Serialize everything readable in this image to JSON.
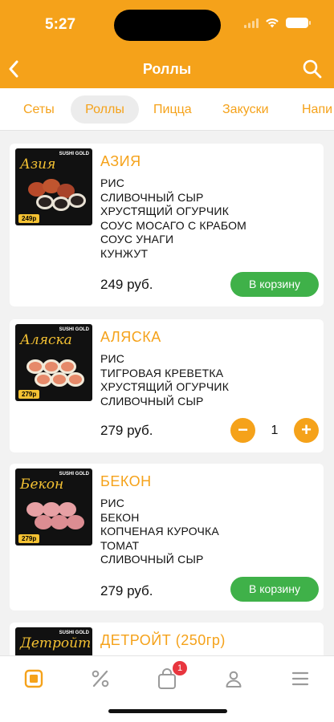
{
  "status_bar": {
    "time": "5:27"
  },
  "nav": {
    "title": "Роллы"
  },
  "tabs": [
    {
      "label": "Сеты"
    },
    {
      "label": "Роллы"
    },
    {
      "label": "Пицца"
    },
    {
      "label": "Закуски"
    },
    {
      "label": "Напи"
    }
  ],
  "products": [
    {
      "name": "АЗИЯ",
      "thumb_name": "Азия",
      "thumb_brand": "SUSHI GOLD",
      "thumb_price": "249р",
      "ingredients": [
        "РИС",
        "СЛИВОЧНЫЙ СЫР",
        "ХРУСТЯЩИЙ ОГУРЧИК",
        "СОУС МОСАГО С КРАБОМ",
        "СОУС УНАГИ",
        "КУНЖУТ"
      ],
      "price": "249 руб.",
      "button_label": "В корзину"
    },
    {
      "name": "АЛЯСКА",
      "thumb_name": "Аляска",
      "thumb_brand": "SUSHI GOLD",
      "thumb_price": "279р",
      "ingredients": [
        "РИС",
        "ТИГРОВАЯ КРЕВЕТКА",
        "ХРУСТЯЩИЙ ОГУРЧИК",
        "СЛИВОЧНЫЙ СЫР"
      ],
      "price": "279 руб.",
      "quantity": "1",
      "minus": "−",
      "plus": "+"
    },
    {
      "name": "БЕКОН",
      "thumb_name": "Бекон",
      "thumb_brand": "SUSHI GOLD",
      "thumb_price": "279р",
      "ingredients": [
        "РИС",
        "БЕКОН",
        "КОПЧЕНАЯ КУРОЧКА",
        "ТОМАТ",
        "СЛИВОЧНЫЙ СЫР"
      ],
      "price": "279 руб.",
      "button_label": "В корзину"
    },
    {
      "name": "ДЕТРОЙТ (250гр)",
      "thumb_name": "Детройт",
      "thumb_brand": "SUSHI GOLD"
    }
  ],
  "bottom_nav": {
    "items": [
      {
        "icon": "menu-catalog-icon"
      },
      {
        "icon": "percent-icon"
      },
      {
        "icon": "shopping-bag-icon",
        "badge": "1"
      },
      {
        "icon": "profile-icon"
      },
      {
        "icon": "hamburger-menu-icon"
      }
    ]
  },
  "colors": {
    "accent": "#f5a21a",
    "green": "#3fb149",
    "badge": "#e8363f"
  }
}
